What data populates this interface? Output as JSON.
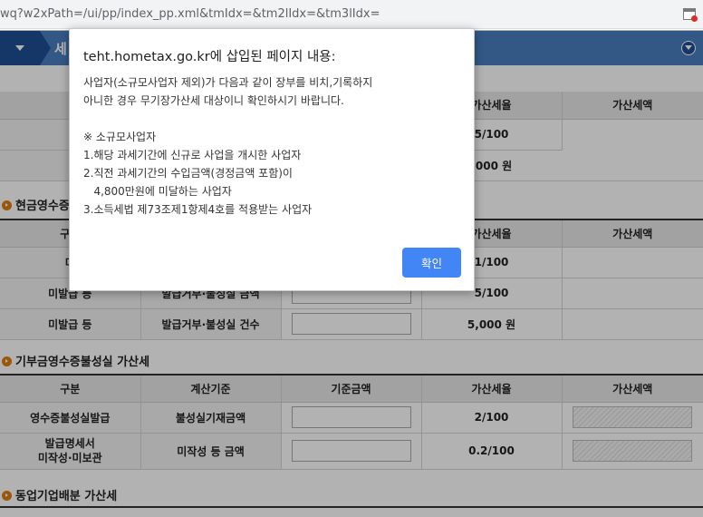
{
  "browser": {
    "url": "wq?w2xPath=/ui/pp/index_pp.xml&tmIdx=&tm2lIdx=&tm3lIdx="
  },
  "header": {
    "title_partial": "세"
  },
  "section1": {
    "headers": [
      "",
      "",
      "",
      "가산세율",
      "가산세액"
    ],
    "rows": [
      {
        "rate": "5/100"
      },
      {
        "rate": ",000 원"
      }
    ]
  },
  "section2": {
    "title": "현금영수증",
    "headers": [
      "구분",
      "",
      "",
      "가산세율",
      "가산세액"
    ],
    "rows": [
      {
        "type": "미",
        "basis": "",
        "rate": "1/100"
      },
      {
        "type": "미발급 등",
        "basis": "발급거부·불성실 금액",
        "rate": "5/100"
      },
      {
        "type": "미발급 등",
        "basis": "발급거부·불성실 건수",
        "rate": "5,000 원"
      }
    ]
  },
  "section3": {
    "title": "기부금영수증불성실 가산세",
    "headers": [
      "구분",
      "계산기준",
      "기준금액",
      "가산세율",
      "가산세액"
    ],
    "rows": [
      {
        "type": "영수증불성실발급",
        "basis": "불성실기재금액",
        "rate": "2/100"
      },
      {
        "type": "발급명세서\n미작성·미보관",
        "basis": "미작성 등 금액",
        "rate": "0.2/100"
      }
    ]
  },
  "section4": {
    "title": "동업기업배분 가산세"
  },
  "dialog": {
    "title": "teht.hometax.go.kr에 삽입된 페이지 내용:",
    "lines": [
      "사업자(소규모사업자 제외)가 다음과 같이 장부를 비치,기록하지",
      "아니한 경우 무기장가산세 대상이니 확인하시기 바랍니다.",
      "",
      "※ 소규모사업자",
      "1.해당 과세기간에 신규로 사업을 개시한 사업자",
      "2.직전 과세기간의 수입금액(경정금액 포함)이",
      "   4,800만원에 미달하는 사업자",
      "3.소득세법 제73조제1항제4호를 적용받는 사업자"
    ],
    "ok_label": "확인"
  },
  "colors": {
    "header_blue": "#4a7fc1",
    "header_dark": "#1f4f96",
    "button_blue": "#4285f4",
    "bullet_orange": "#e07b10"
  },
  "icons": {
    "menu": "caret-down-icon",
    "collapse": "circle-chevron-down-icon",
    "extension": "popup-blocked-icon",
    "section": "orange-arrow-bullet-icon"
  }
}
